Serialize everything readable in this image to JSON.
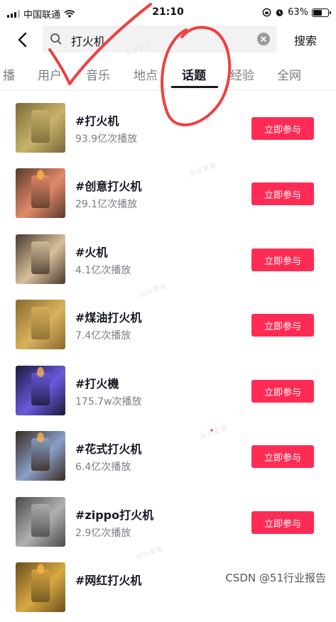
{
  "status_bar": {
    "carrier": "中国联通",
    "time": "21:10",
    "battery": "63%",
    "battery_level": 0.63
  },
  "search": {
    "query": "打火机",
    "submit_label": "搜索"
  },
  "tabs": [
    {
      "label": "播",
      "active": false
    },
    {
      "label": "用户",
      "active": false
    },
    {
      "label": "音乐",
      "active": false
    },
    {
      "label": "地点",
      "active": false
    },
    {
      "label": "话题",
      "active": true
    },
    {
      "label": "经验",
      "active": false
    },
    {
      "label": "全网",
      "active": false
    }
  ],
  "topics": [
    {
      "title": "#打火机",
      "plays": "93.9亿次播放",
      "button": "立即参与",
      "thumb_colors": [
        "#7a6a3a",
        "#c8b26a"
      ]
    },
    {
      "title": "#创意打火机",
      "plays": "29.1亿次播放",
      "button": "立即参与",
      "thumb_colors": [
        "#5a3a2a",
        "#e28a6a"
      ]
    },
    {
      "title": "#火机",
      "plays": "4.1亿次播放",
      "button": "立即参与",
      "thumb_colors": [
        "#4a3a30",
        "#d8c09a"
      ]
    },
    {
      "title": "#煤油打火机",
      "plays": "7.4亿次播放",
      "button": "立即参与",
      "thumb_colors": [
        "#8a6a30",
        "#d8b25a"
      ]
    },
    {
      "title": "#打火機",
      "plays": "175.7w次播放",
      "button": "立即参与",
      "thumb_colors": [
        "#1a1a3a",
        "#6a5adc"
      ]
    },
    {
      "title": "#花式打火机",
      "plays": "6.4亿次播放",
      "button": "立即参与",
      "thumb_colors": [
        "#3a2a20",
        "#8aa0c8"
      ]
    },
    {
      "title": "#zippo打火机",
      "plays": "2.9亿次播放",
      "button": "立即参与",
      "thumb_colors": [
        "#4a4a4a",
        "#b0b0b0"
      ]
    },
    {
      "title": "#网红打火机",
      "plays": "",
      "button": "",
      "thumb_colors": [
        "#6a5020",
        "#d8a840"
      ]
    }
  ],
  "watermark": "CSDN @51行业报告",
  "colors": {
    "accent": "#fe2c55",
    "text_primary": "#161823",
    "text_secondary": "#7b7c83",
    "annotation": "#ee4040"
  },
  "icons": [
    "signal-icon",
    "wifi-icon",
    "lock-rotation-icon",
    "alarm-icon",
    "battery-icon",
    "back-arrow-icon",
    "search-icon",
    "clear-icon"
  ]
}
